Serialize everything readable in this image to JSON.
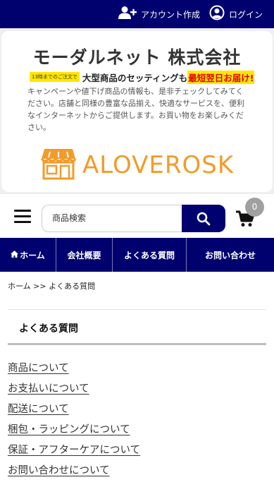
{
  "header": {
    "account_create_label": "アカウント作成",
    "login_label": "ログイン",
    "brand_color": "#00006e",
    "icons": [
      "add-user-icon",
      "user-circle-icon"
    ]
  },
  "banner": {
    "company_name": "モーダルネット 株式会社",
    "promo_cutoff": "13時までのご注文で",
    "promo_main": "大型商品のセッティングも",
    "promo_highlight": "最短翌日お届け!",
    "description": "キャンペーンや値下げ商品の情報も、是非チェックしてみてください。店舗と同様の豊富な品揃え、快適なサービスを、便利なインターネットからご提供します。お買い物をお楽しみください。",
    "logo_text": "ALOVEROSK",
    "logo_color": "#f39b2a"
  },
  "search": {
    "placeholder": "商品検索",
    "value": ""
  },
  "cart": {
    "count": "0"
  },
  "nav": {
    "items": [
      {
        "label": "ホーム",
        "icon": "home-icon"
      },
      {
        "label": "会社概要"
      },
      {
        "label": "よくある質問"
      },
      {
        "label": "お問い合わせ"
      }
    ]
  },
  "breadcrumb": {
    "text": "ホーム >> よくある質問"
  },
  "faq": {
    "title": "よくある質問",
    "links": [
      "商品について",
      "お支払いについて",
      "配送について",
      "梱包・ラッピングについて",
      "保証・アフターケアについて",
      "お問い合わせについて"
    ]
  }
}
